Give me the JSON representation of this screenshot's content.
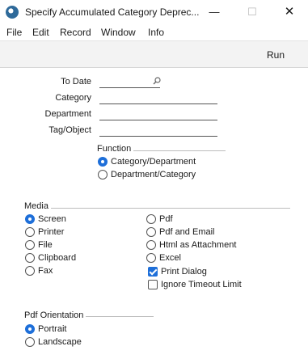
{
  "window": {
    "title": "Specify Accumulated Category Deprec...",
    "minimize_glyph": "—",
    "maximize_glyph": "☐",
    "close_glyph": "✕"
  },
  "menu": [
    "File",
    "Edit",
    "Record",
    "Window",
    "Info"
  ],
  "toolbar": {
    "run_label": "Run"
  },
  "fields": {
    "to_date": {
      "label": "To Date",
      "value": ""
    },
    "category": {
      "label": "Category",
      "value": ""
    },
    "department": {
      "label": "Department",
      "value": ""
    },
    "tag_object": {
      "label": "Tag/Object",
      "value": ""
    }
  },
  "function": {
    "label": "Function",
    "options": [
      {
        "label": "Category/Department",
        "selected": true
      },
      {
        "label": "Department/Category",
        "selected": false
      }
    ]
  },
  "media": {
    "label": "Media",
    "left_options": [
      {
        "label": "Screen",
        "selected": true
      },
      {
        "label": "Printer",
        "selected": false
      },
      {
        "label": "File",
        "selected": false
      },
      {
        "label": "Clipboard",
        "selected": false
      },
      {
        "label": "Fax",
        "selected": false
      }
    ],
    "right_options": [
      {
        "label": "Pdf",
        "selected": false
      },
      {
        "label": "Pdf and Email",
        "selected": false
      },
      {
        "label": "Html as Attachment",
        "selected": false
      },
      {
        "label": "Excel",
        "selected": false
      }
    ],
    "checkboxes": [
      {
        "label": "Print Dialog",
        "checked": true
      },
      {
        "label": "Ignore Timeout Limit",
        "checked": false
      }
    ]
  },
  "pdf_orientation": {
    "label": "Pdf Orientation",
    "options": [
      {
        "label": "Portrait",
        "selected": true
      },
      {
        "label": "Landscape",
        "selected": false
      }
    ]
  },
  "colors": {
    "accent": "#1e6fd9",
    "toolbar_bg": "#f3f3f3"
  },
  "icons": {
    "app": "app-logo-icon",
    "paste_special": "magnifier-icon"
  }
}
